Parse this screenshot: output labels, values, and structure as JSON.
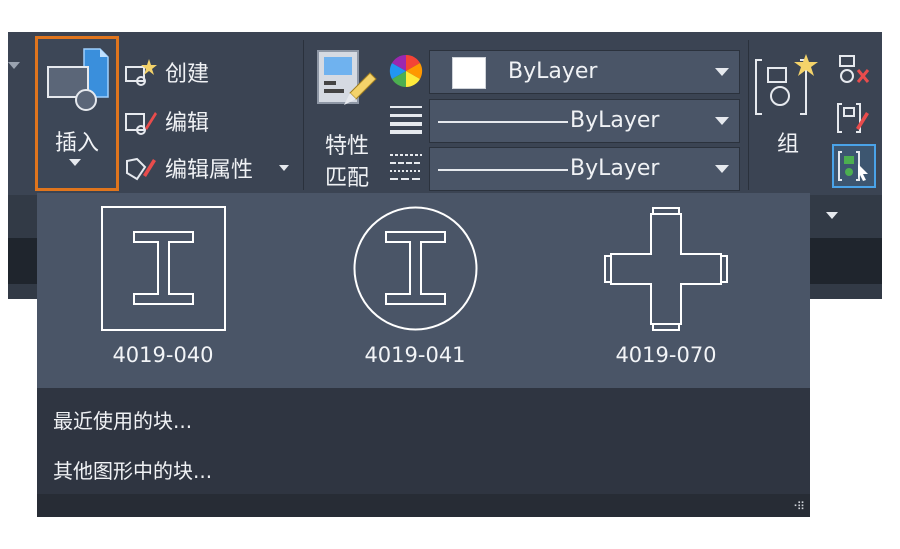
{
  "ribbon": {
    "insert_label": "插入",
    "commands": [
      {
        "label": "创建",
        "icon": "block-create-icon"
      },
      {
        "label": "编辑",
        "icon": "block-edit-icon"
      },
      {
        "label": "编辑属性",
        "icon": "edit-attributes-icon"
      }
    ],
    "match_properties": {
      "line1": "特性",
      "line2": "匹配"
    },
    "property_combos": [
      {
        "label": "ByLayer",
        "type": "color"
      },
      {
        "label": "ByLayer",
        "type": "lineweight"
      },
      {
        "label": "ByLayer",
        "type": "linetype"
      }
    ],
    "group_label": "组"
  },
  "dropdown": {
    "blocks": [
      {
        "name": "4019-040",
        "icon": "i-beam-square-icon"
      },
      {
        "name": "4019-041",
        "icon": "i-beam-circle-icon"
      },
      {
        "name": "4019-070",
        "icon": "cross-icon"
      }
    ],
    "menu": {
      "recent_blocks": "最近使用的块...",
      "other_drawings": "其他图形中的块..."
    }
  },
  "colors": {
    "highlight": "#e0751d",
    "panel": "#3b4453",
    "gallery": "#4a5567"
  }
}
